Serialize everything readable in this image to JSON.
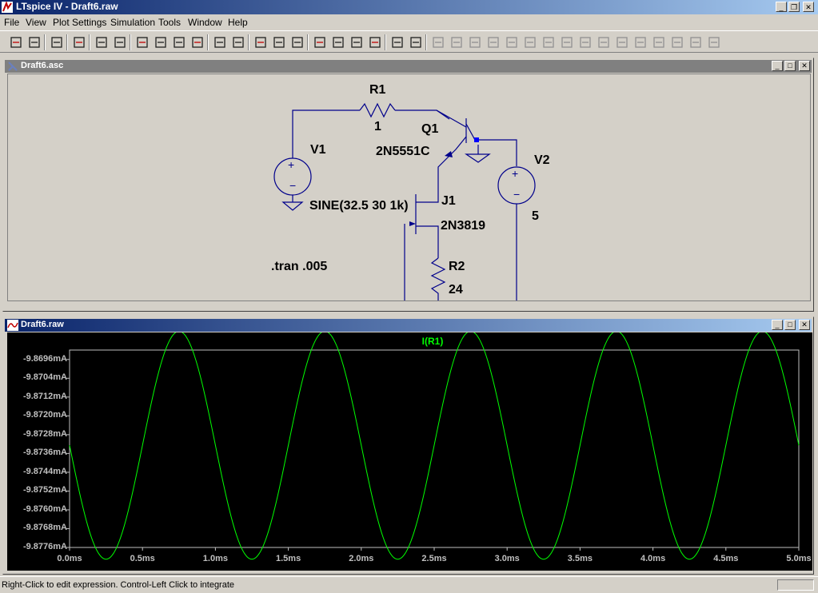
{
  "app": {
    "title": "LTspice IV - Draft6.raw"
  },
  "menu": [
    "File",
    "View",
    "Plot Settings",
    "Simulation",
    "Tools",
    "Window",
    "Help"
  ],
  "toolbar_icons": [
    "new-schematic-icon",
    "open-icon",
    "save-icon",
    "control-panel-icon",
    "run-icon",
    "halt-icon",
    "zoom-in-icon",
    "zoom-area-icon",
    "zoom-out-icon",
    "zoom-cancel-icon",
    "autorange-icon",
    "plot-settings-icon",
    "tile-horizontal-icon",
    "cascade-icon",
    "tile-vertical-icon",
    "cut-icon",
    "copy-icon",
    "paste-icon",
    "find-icon",
    "print-setup-icon",
    "print-icon",
    "wire-icon",
    "ground-icon",
    "label-net-icon",
    "resistor-icon",
    "capacitor-icon",
    "inductor-icon",
    "diode-icon",
    "component-icon",
    "move-icon",
    "drag-icon",
    "undo-icon",
    "redo-icon",
    "rotate-icon",
    "mirror-icon",
    "text-icon",
    "spice-directive-icon"
  ],
  "schematic": {
    "title": "Draft6.asc",
    "labels": {
      "r1_name": "R1",
      "r1_value": "1",
      "q1_name": "Q1",
      "q1_model": "2N5551C",
      "v1_name": "V1",
      "v1_value": "SINE(32.5 30 1k)",
      "v2_name": "V2",
      "v2_value": "5",
      "j1_name": "J1",
      "j1_model": "2N3819",
      "r2_name": "R2",
      "r2_value": "24",
      "directive": ".tran .005"
    }
  },
  "plot": {
    "title": "Draft6.raw",
    "trace_name": "I(R1)",
    "colors": {
      "trace": "#00ff00",
      "axis": "#c0c0c0",
      "background": "#000000"
    }
  },
  "chart_data": {
    "type": "line",
    "title": "",
    "xlabel": "",
    "ylabel": "",
    "series": [
      {
        "name": "I(R1)",
        "function": "sine",
        "offset_mA": -9.87325,
        "amplitude_mA": 0.00485,
        "frequency_hz": 1000,
        "peak_at_ms": 0.75
      }
    ],
    "xlim": [
      0,
      5.0
    ],
    "ylim": [
      -9.8776,
      -9.8692
    ],
    "x_ticks": [
      "0.0ms",
      "0.5ms",
      "1.0ms",
      "1.5ms",
      "2.0ms",
      "2.5ms",
      "3.0ms",
      "3.5ms",
      "4.0ms",
      "4.5ms",
      "5.0ms"
    ],
    "x_tick_values": [
      0,
      0.5,
      1.0,
      1.5,
      2.0,
      2.5,
      3.0,
      3.5,
      4.0,
      4.5,
      5.0
    ],
    "y_ticks": [
      "-9.8696mA",
      "-9.8704mA",
      "-9.8712mA",
      "-9.8720mA",
      "-9.8728mA",
      "-9.8736mA",
      "-9.8744mA",
      "-9.8752mA",
      "-9.8760mA",
      "-9.8768mA",
      "-9.8776mA"
    ],
    "y_tick_values": [
      -9.8696,
      -9.8704,
      -9.8712,
      -9.872,
      -9.8728,
      -9.8736,
      -9.8744,
      -9.8752,
      -9.876,
      -9.8768,
      -9.8776
    ],
    "grid": false
  },
  "status": {
    "text": "Right-Click to edit expression. Control-Left Click to integrate"
  }
}
